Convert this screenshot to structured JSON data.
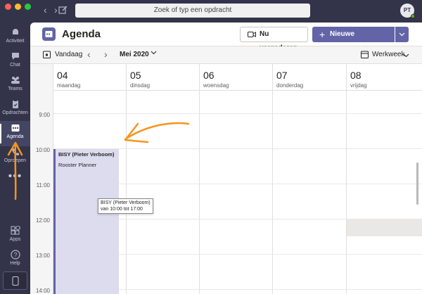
{
  "window": {
    "search_placeholder": "Zoek of typ een opdracht",
    "avatar_initials": "PT"
  },
  "rail": [
    {
      "label": "Activiteit",
      "icon": "bell-icon"
    },
    {
      "label": "Chat",
      "icon": "chat-icon"
    },
    {
      "label": "Teams",
      "icon": "teams-icon"
    },
    {
      "label": "Opdrachten",
      "icon": "assignments-icon"
    },
    {
      "label": "Agenda",
      "icon": "calendar-icon",
      "active": true
    },
    {
      "label": "Oproepen",
      "icon": "phone-icon"
    },
    {
      "label": "Apps",
      "icon": "apps-icon"
    },
    {
      "label": "Help",
      "icon": "help-icon"
    }
  ],
  "rail_more": "•••",
  "header": {
    "title": "Agenda",
    "meet_now": "Nu vergaderen",
    "new_meeting": "Nieuwe vergadering"
  },
  "toolbar": {
    "today": "Vandaag",
    "month": "Mei 2020",
    "view": "Werkweek"
  },
  "days": [
    {
      "num": "04",
      "name": "maandag"
    },
    {
      "num": "05",
      "name": "dinsdag"
    },
    {
      "num": "06",
      "name": "woensdag"
    },
    {
      "num": "07",
      "name": "donderdag"
    },
    {
      "num": "08",
      "name": "vrijdag"
    }
  ],
  "times": [
    "9:00",
    "10:00",
    "11:00",
    "12:00",
    "13:00",
    "14:00"
  ],
  "event": {
    "title": "BISY (Pieter Verboom)",
    "subtitle": "Rooster Planner"
  },
  "tooltip": {
    "title": "BISY (Pieter Verboom)",
    "time": "van 10:00 tot 17:00"
  },
  "colors": {
    "rail_bg": "#33344a",
    "accent": "#6264a7",
    "event_bg": "#dddbee",
    "annotation": "#f7941d"
  }
}
